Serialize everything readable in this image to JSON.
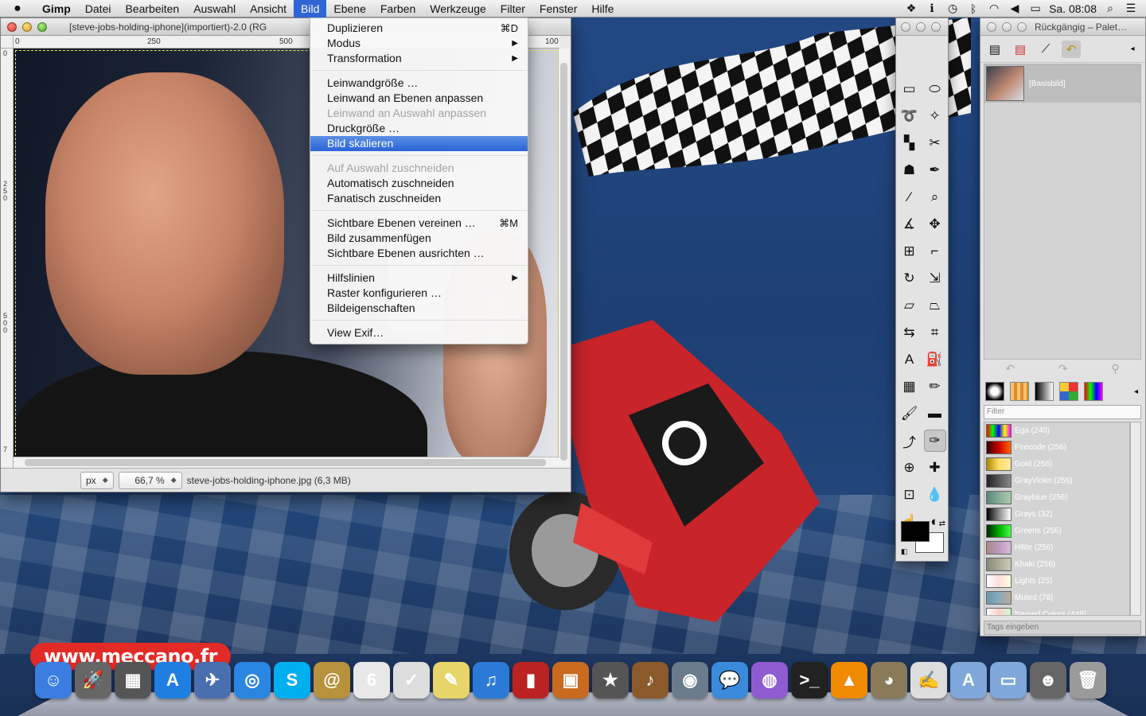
{
  "menubar": {
    "apple": "",
    "items": [
      {
        "label": "Gimp"
      },
      {
        "label": "Datei"
      },
      {
        "label": "Bearbeiten"
      },
      {
        "label": "Auswahl"
      },
      {
        "label": "Ansicht"
      },
      {
        "label": "Bild"
      },
      {
        "label": "Ebene"
      },
      {
        "label": "Farben"
      },
      {
        "label": "Werkzeuge"
      },
      {
        "label": "Filter"
      },
      {
        "label": "Fenster"
      },
      {
        "label": "Hilfe"
      }
    ],
    "active_index": 5,
    "clock": "Sa. 08:08",
    "status_icons": [
      "dropbox-icon",
      "info-icon",
      "time-machine-icon",
      "bluetooth-icon",
      "wifi-icon",
      "volume-icon",
      "battery-icon",
      "spotlight-icon",
      "list-icon"
    ]
  },
  "image_window": {
    "title": "[steve-jobs-holding-iphone](importiert)-2.0 (RG",
    "ruler_top": [
      "0",
      "250",
      "500",
      "100"
    ],
    "ruler_left": [
      "0",
      "250",
      "500",
      "7"
    ],
    "status": {
      "unit": "px",
      "zoom": "66,7 %",
      "file_info": "steve-jobs-holding-iphone.jpg (6,3 MB)"
    }
  },
  "bild_menu": {
    "groups": [
      [
        {
          "label": "Duplizieren",
          "shortcut": "⌘D",
          "disabled": false
        },
        {
          "label": "Modus",
          "submenu": true,
          "disabled": false
        },
        {
          "label": "Transformation",
          "submenu": true,
          "disabled": false
        }
      ],
      [
        {
          "label": "Leinwandgröße …",
          "disabled": false
        },
        {
          "label": "Leinwand an Ebenen anpassen",
          "disabled": false
        },
        {
          "label": "Leinwand an Auswahl anpassen",
          "disabled": true
        },
        {
          "label": "Druckgröße …",
          "disabled": false
        },
        {
          "label": "Bild skalieren",
          "disabled": false,
          "highlighted": true
        }
      ],
      [
        {
          "label": "Auf Auswahl zuschneiden",
          "disabled": true
        },
        {
          "label": "Automatisch zuschneiden",
          "disabled": false
        },
        {
          "label": "Fanatisch zuschneiden",
          "disabled": false
        }
      ],
      [
        {
          "label": "Sichtbare Ebenen vereinen …",
          "shortcut": "⌘M",
          "disabled": false
        },
        {
          "label": "Bild zusammenfügen",
          "disabled": false
        },
        {
          "label": "Sichtbare Ebenen ausrichten …",
          "disabled": false
        }
      ],
      [
        {
          "label": "Hilfslinien",
          "submenu": true,
          "disabled": false
        },
        {
          "label": "Raster konfigurieren …",
          "disabled": false
        },
        {
          "label": "Bildeigenschaften",
          "disabled": false
        }
      ],
      [
        {
          "label": "View Exif…",
          "disabled": false
        }
      ]
    ]
  },
  "toolbox": {
    "tools": [
      "rect-select-icon",
      "ellipse-select-icon",
      "lasso-icon",
      "fuzzy-select-icon",
      "color-select-icon",
      "scissors-icon",
      "foreground-select-icon",
      "paths-icon",
      "color-picker-icon",
      "zoom-icon",
      "measure-icon",
      "move-icon",
      "align-icon",
      "crop-icon",
      "rotate-icon",
      "scale-icon",
      "shear-icon",
      "perspective-icon",
      "flip-icon",
      "cage-icon",
      "text-icon",
      "bucket-fill-icon",
      "blend-icon",
      "pencil-icon",
      "paintbrush-icon",
      "eraser-icon",
      "airbrush-icon",
      "ink-icon",
      "clone-icon",
      "heal-icon",
      "perspective-clone-icon",
      "blur-icon",
      "smudge-icon",
      "dodge-icon"
    ],
    "selected_index": 27,
    "fg_color": "#000000",
    "bg_color": "#ffffff"
  },
  "dock_panel": {
    "title": "Rückgängig – Palet…",
    "layer_name": "[Basisbild]",
    "filter_placeholder": "Filter",
    "tags_placeholder": "Tags eingeben",
    "palettes": [
      {
        "name": "Ega (240)",
        "color": "linear-gradient(90deg,#f00,#0f0,#00f,#ff0,#f0f)"
      },
      {
        "name": "Firecode (256)",
        "color": "linear-gradient(90deg,#300,#c00,#f60)"
      },
      {
        "name": "Gold (256)",
        "color": "linear-gradient(90deg,#a80,#fd6,#ffe8a0)"
      },
      {
        "name": "GrayViolet (256)",
        "color": "linear-gradient(90deg,#222,#555,#888)"
      },
      {
        "name": "Grayblue (256)",
        "color": "linear-gradient(90deg,#587,#8a9,#aca)"
      },
      {
        "name": "Grays (32)",
        "color": "linear-gradient(90deg,#000,#888,#fff)"
      },
      {
        "name": "Greens (256)",
        "color": "linear-gradient(90deg,#020,#0a0,#4f4)"
      },
      {
        "name": "Hilite (256)",
        "color": "linear-gradient(90deg,#a88,#b9b,#dbd)"
      },
      {
        "name": "Khaki (256)",
        "color": "linear-gradient(90deg,#887,#aa9,#ccb)"
      },
      {
        "name": "Lights (25)",
        "color": "linear-gradient(90deg,#fff,#fdd,#ffd)"
      },
      {
        "name": "Muted (78)",
        "color": "linear-gradient(90deg,#69a,#8ab,#ba9)"
      },
      {
        "name": "Named Colors (448)",
        "color": "linear-gradient(90deg,#fff,#fcc,#cfc)"
      }
    ]
  },
  "desktop": {
    "meccano_url": "www.meccano.fr"
  },
  "mac_dock": {
    "items": [
      {
        "name": "finder-icon",
        "glyph": "☺",
        "color": "#3b7de0"
      },
      {
        "name": "launchpad-icon",
        "glyph": "🚀",
        "color": "#666"
      },
      {
        "name": "photo-booth-icon",
        "glyph": "▦",
        "color": "#555"
      },
      {
        "name": "app-store-icon",
        "glyph": "A",
        "color": "#1f7fe0"
      },
      {
        "name": "preview-icon",
        "glyph": "✈",
        "color": "#4a6fb0"
      },
      {
        "name": "safari-icon",
        "glyph": "◎",
        "color": "#2a86e0"
      },
      {
        "name": "skype-icon",
        "glyph": "S",
        "color": "#00aff0"
      },
      {
        "name": "mail-icon",
        "glyph": "@",
        "color": "#b8913c"
      },
      {
        "name": "calendar-icon",
        "glyph": "6",
        "color": "#e8e8e8"
      },
      {
        "name": "reminders-icon",
        "glyph": "✓",
        "color": "#ddd"
      },
      {
        "name": "notes-icon",
        "glyph": "✎",
        "color": "#e8d56a"
      },
      {
        "name": "itunes-icon",
        "glyph": "♫",
        "color": "#2b7ad8"
      },
      {
        "name": "photo-booth-red-icon",
        "glyph": "▮",
        "color": "#b22"
      },
      {
        "name": "iphoto-icon",
        "glyph": "▣",
        "color": "#c86a20"
      },
      {
        "name": "imovie-icon",
        "glyph": "★",
        "color": "#555"
      },
      {
        "name": "garageband-icon",
        "glyph": "♪",
        "color": "#8b5a2b"
      },
      {
        "name": "facetime-icon",
        "glyph": "◉",
        "color": "#6a7c8c"
      },
      {
        "name": "messages-icon",
        "glyph": "💬",
        "color": "#3a8bdc"
      },
      {
        "name": "ical-sphere-icon",
        "glyph": "◍",
        "color": "#8e5bd0"
      },
      {
        "name": "terminal-icon",
        "glyph": ">_",
        "color": "#222"
      },
      {
        "name": "vlc-icon",
        "glyph": "▲",
        "color": "#f08a00"
      },
      {
        "name": "gimp-icon",
        "glyph": "◕",
        "color": "#8a7a5a"
      },
      {
        "name": "textedit-icon",
        "glyph": "✍",
        "color": "#ddd"
      },
      {
        "name": "applications-folder-icon",
        "glyph": "A",
        "color": "#7fa7d9"
      },
      {
        "name": "documents-folder-icon",
        "glyph": "▭",
        "color": "#7fa7d9"
      },
      {
        "name": "downloads-stack-icon",
        "glyph": "☻",
        "color": "#666"
      },
      {
        "name": "trash-icon",
        "glyph": "🗑",
        "color": "#9a9a9a"
      }
    ]
  }
}
